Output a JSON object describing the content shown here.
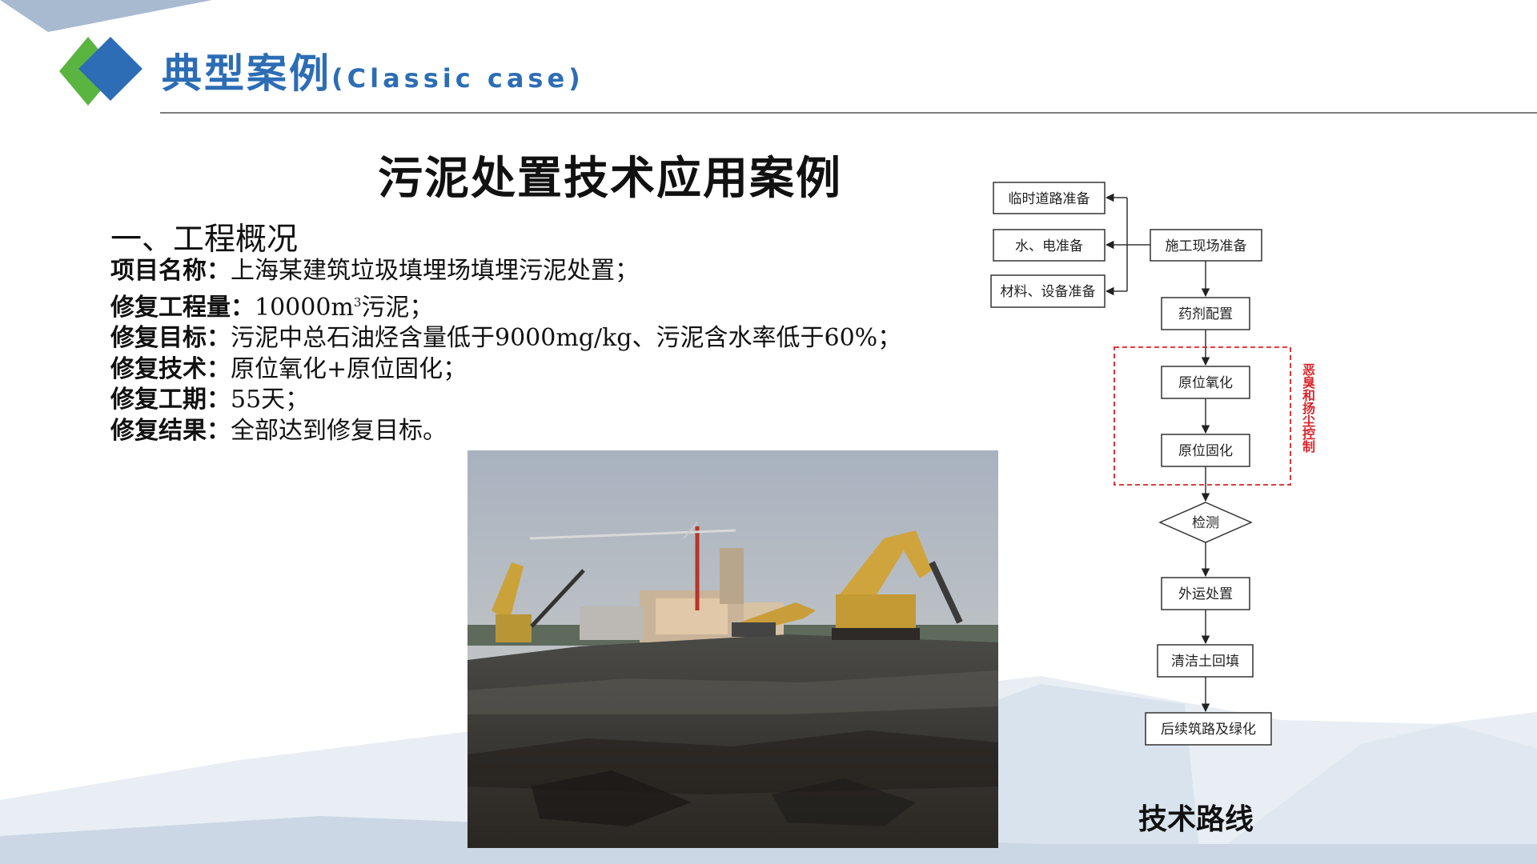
{
  "header": {
    "title": "典型案例",
    "subtitle": "(Classic case)"
  },
  "main_title": "污泥处置技术应用案例",
  "section_heading": "一、工程概况",
  "info_rows": [
    {
      "label": "项目名称：",
      "value": "上海某建筑垃圾填埋场填埋污泥处置；"
    },
    {
      "label": "修复工程量：",
      "value_prefix": "10000m",
      "value_sup": "3",
      "value_suffix": "污泥；"
    },
    {
      "label": "修复目标：",
      "value": "污泥中总石油烃含量低于9000mg/kg、污泥含水率低于60%；"
    },
    {
      "label": "修复技术：",
      "value": "原位氧化+原位固化；"
    },
    {
      "label": "修复工期：",
      "value": "55天；"
    },
    {
      "label": "修复结果：",
      "value": "全部达到修复目标。"
    }
  ],
  "flowchart": {
    "nodes": [
      "临时道路准备",
      "水、电准备",
      "材料、设备准备",
      "施工现场准备",
      "药剂配置",
      "原位氧化",
      "原位固化",
      "检测",
      "外运处置",
      "清洁土回填",
      "后续筑路及绿化"
    ],
    "control_label": "恶臭和扬尘控制",
    "caption": "技术路线",
    "control_color": "#d9232a"
  },
  "colors": {
    "brand_blue": "#2c6db5",
    "brand_green": "#5ab540",
    "accent_red": "#d9232a"
  }
}
